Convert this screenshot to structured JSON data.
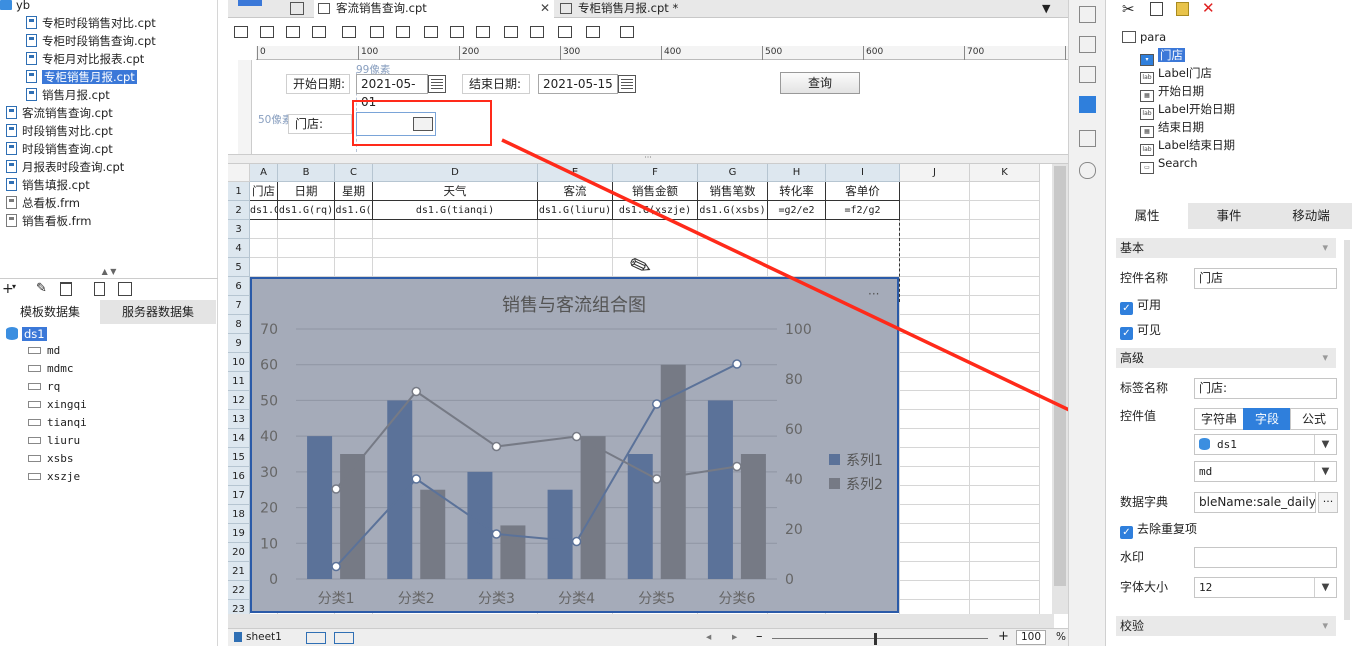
{
  "left_tree": {
    "root": "yb",
    "items": [
      {
        "label": "专柜时段销售对比.cpt",
        "type": "cpt"
      },
      {
        "label": "专柜时段销售查询.cpt",
        "type": "cpt"
      },
      {
        "label": "专柜月对比报表.cpt",
        "type": "cpt"
      },
      {
        "label": "专柜销售月报.cpt",
        "type": "cpt"
      },
      {
        "label": "销售月报.cpt",
        "type": "cpt"
      },
      {
        "label": "客流销售查询.cpt",
        "type": "cpt"
      },
      {
        "label": "时段销售对比.cpt",
        "type": "cpt"
      },
      {
        "label": "时段销售查询.cpt",
        "type": "cpt"
      },
      {
        "label": "月报表时段查询.cpt",
        "type": "cpt"
      },
      {
        "label": "销售填报.cpt",
        "type": "cpt"
      },
      {
        "label": "总看板.frm",
        "type": "frm"
      },
      {
        "label": "销售看板.frm",
        "type": "frm"
      }
    ]
  },
  "datasets": {
    "tabs": [
      "模板数据集",
      "服务器数据集"
    ],
    "name": "ds1",
    "fields": [
      "md",
      "mdmc",
      "rq",
      "xingqi",
      "tianqi",
      "liuru",
      "xsbs",
      "xszje"
    ]
  },
  "editor_tabs": [
    {
      "label": "客流销售查询.cpt"
    },
    {
      "label": "专柜销售月报.cpt *"
    }
  ],
  "ruler_ticks": [
    "0",
    "100",
    "200",
    "300",
    "400",
    "500",
    "600",
    "700",
    "800"
  ],
  "param": {
    "hint_top": "99像素",
    "hint_left": "50像素",
    "start_label": "开始日期:",
    "start_value": "2021-05-01",
    "end_label": "结束日期:",
    "end_value": "2021-05-15",
    "query_button": "查询",
    "store_label": "门店:"
  },
  "sheet": {
    "columns": [
      "A",
      "B",
      "C",
      "D",
      "E",
      "F",
      "G",
      "H",
      "I",
      "J",
      "K"
    ],
    "rows": [
      "1",
      "2",
      "3",
      "4",
      "5",
      "6",
      "7",
      "8",
      "9",
      "10",
      "11",
      "12",
      "13",
      "14",
      "15",
      "16",
      "17",
      "18",
      "19",
      "20",
      "21",
      "22",
      "23"
    ],
    "header_row": [
      "门店",
      "日期",
      "星期",
      "天气",
      "客流",
      "销售金额",
      "销售笔数",
      "转化率",
      "客单价"
    ],
    "data_row": [
      "ds1.G(",
      "ds1.G(rq)",
      "ds1.G(",
      "ds1.G(tianqi)",
      "ds1.G(liuru)",
      "ds1.G(xszje)",
      "ds1.G(xsbs)",
      "=g2/e2",
      "=f2/g2"
    ],
    "sheet_name": "sheet1",
    "zoom": "100"
  },
  "chart_data": {
    "type": "bar",
    "title": "销售与客流组合图",
    "categories": [
      "分类1",
      "分类2",
      "分类3",
      "分类4",
      "分类5",
      "分类6"
    ],
    "series": [
      {
        "name": "系列1",
        "type": "bar",
        "axis": "left",
        "values": [
          40,
          50,
          30,
          25,
          35,
          50
        ]
      },
      {
        "name": "系列2",
        "type": "bar",
        "axis": "left",
        "values": [
          35,
          25,
          15,
          40,
          60,
          35
        ]
      },
      {
        "type": "line",
        "axis": "right",
        "values": [
          5,
          40,
          18,
          15,
          70,
          86
        ]
      },
      {
        "type": "line",
        "axis": "right",
        "values": [
          36,
          75,
          53,
          57,
          40,
          45
        ]
      }
    ],
    "left_ticks": [
      "0",
      "10",
      "20",
      "30",
      "40",
      "50",
      "60",
      "70"
    ],
    "right_ticks": [
      "0",
      "20",
      "40",
      "60",
      "80",
      "100"
    ],
    "ylim_left": [
      0,
      70
    ],
    "ylim_right": [
      0,
      100
    ],
    "legend_position": "right",
    "grid": true,
    "colors": {
      "series1": "#5b7299",
      "series2": "#767a85",
      "line": "#5b7299",
      "line2": "#767a85",
      "background": "#a5abb9"
    }
  },
  "widget_tree": {
    "root": "para",
    "items": [
      {
        "label": "门店",
        "icon": "combo",
        "selected": true
      },
      {
        "label": "Label门店",
        "icon": "lab"
      },
      {
        "label": "开始日期",
        "icon": "date"
      },
      {
        "label": "Label开始日期",
        "icon": "lab"
      },
      {
        "label": "结束日期",
        "icon": "date"
      },
      {
        "label": "Label结束日期",
        "icon": "lab"
      },
      {
        "label": "Search",
        "icon": "search"
      }
    ]
  },
  "props": {
    "tabs": [
      "属性",
      "事件",
      "移动端"
    ],
    "basic_section": "基本",
    "widget_name_label": "控件名称",
    "widget_name_value": "门店",
    "enabled_label": "可用",
    "visible_label": "可见",
    "advanced_section": "高级",
    "tag_name_label": "标签名称",
    "tag_name_value": "门店:",
    "widget_value_label": "控件值",
    "value_types": [
      "字符串",
      "字段",
      "公式"
    ],
    "dataset_value": "ds1",
    "field_value": "md",
    "dict_label": "数据字典",
    "dict_value": "bleName:sale_daily]",
    "dict_more": "···",
    "dedupe_label": "去除重复项",
    "watermark_label": "水印",
    "font_size_label": "字体大小",
    "font_size_value": "12",
    "verify_section": "校验"
  },
  "colors": {
    "accent": "#2f7fdc",
    "selection": "#3b78d8",
    "annotation": "#ff2a1a"
  }
}
